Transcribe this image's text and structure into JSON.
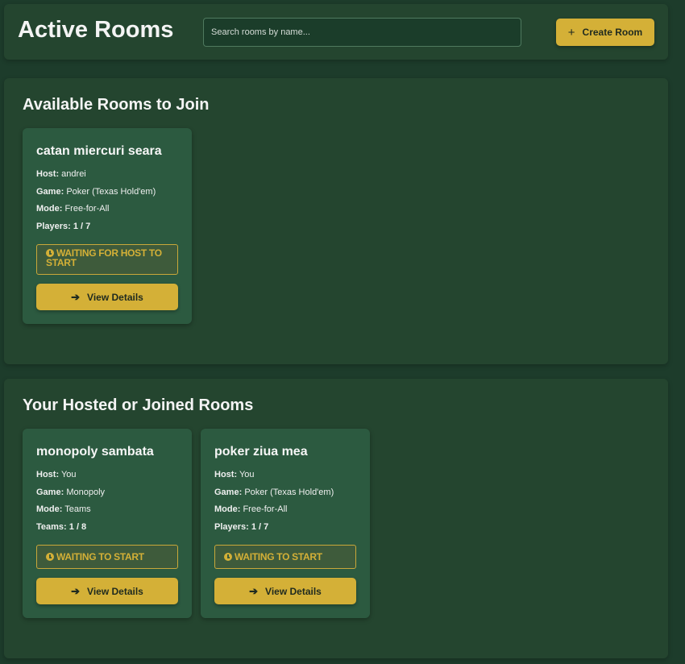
{
  "header": {
    "title": "Active Rooms",
    "search_placeholder": "Search rooms by name...",
    "create_label": "Create Room",
    "create_icon": "+"
  },
  "colors": {
    "background": "#1d3c2b",
    "panel": "#24452f",
    "card": "#2c5a40",
    "accent": "#d4b037"
  },
  "available": {
    "title": "Available Rooms to Join",
    "rooms": [
      {
        "name": "catan miercuri seara",
        "host_label": "Host:",
        "host": "andrei",
        "game_label": "Game:",
        "game": "Poker (Texas Hold'em)",
        "mode_label": "Mode:",
        "mode": "Free-for-All",
        "count_label": "Players:",
        "count": "1 / 7",
        "status": "WAITING FOR HOST TO START",
        "button": "View Details"
      }
    ]
  },
  "hosted": {
    "title": "Your Hosted or Joined Rooms",
    "rooms": [
      {
        "name": "monopoly sambata",
        "host_label": "Host:",
        "host": "You",
        "game_label": "Game:",
        "game": "Monopoly",
        "mode_label": "Mode:",
        "mode": "Teams",
        "count_label": "Teams:",
        "count": "1 / 8",
        "status": "WAITING TO START",
        "button": "View Details"
      },
      {
        "name": "poker ziua mea",
        "host_label": "Host:",
        "host": "You",
        "game_label": "Game:",
        "game": "Poker (Texas Hold'em)",
        "mode_label": "Mode:",
        "mode": "Free-for-All",
        "count_label": "Players:",
        "count": "1 / 7",
        "status": "WAITING TO START",
        "button": "View Details"
      }
    ]
  }
}
